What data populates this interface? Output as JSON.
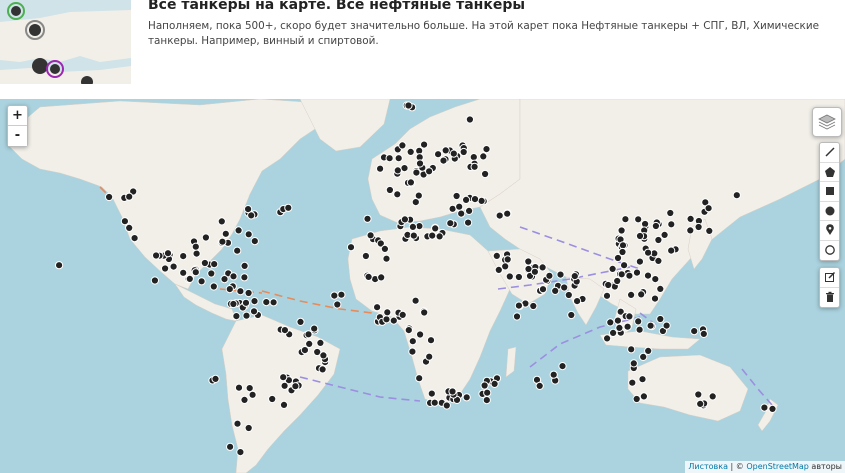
{
  "header": {
    "title": "Все танкеры на карте. Все нефтяные танкеры",
    "description": "Наполняем, пока 500+, скоро будет значительно больше. На этой карет пока Нефтяные танкеры + СПГ, ВЛ, Химические танкеры. Например, винный и спиртовой."
  },
  "map_controls": {
    "zoom_in": "+",
    "zoom_out": "-",
    "layers_icon": "layers-icon",
    "draw_tools": [
      "polyline-icon",
      "polygon-icon",
      "rectangle-icon",
      "circle-icon",
      "marker-icon",
      "circlemarker-icon"
    ],
    "edit_tools": [
      "edit-icon",
      "trash-icon"
    ]
  },
  "attribution": {
    "leaflet": "Листовка",
    "separator": " | © ",
    "osm": "OpenStreetMap",
    "authors": " авторы"
  },
  "colors": {
    "water": "#aad3df",
    "land": "#f2efe9",
    "marker": "#222222",
    "route": "#9c8fe0",
    "route_orange": "#e88b5a"
  }
}
